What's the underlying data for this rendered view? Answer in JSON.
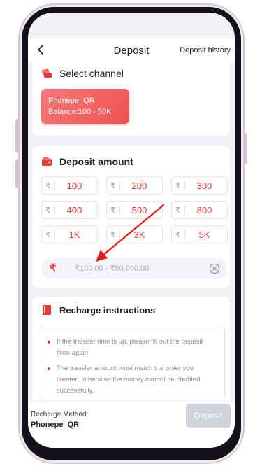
{
  "header": {
    "title": "Deposit",
    "history_link": "Deposit history"
  },
  "select_channel": {
    "title": "Select channel",
    "channel": {
      "name": "Phonepe_QR",
      "balance": "Balance:100 - 50K"
    }
  },
  "deposit_amount": {
    "title": "Deposit amount",
    "currency_symbol": "₹",
    "options": [
      "100",
      "200",
      "300",
      "400",
      "500",
      "800",
      "1K",
      "3K",
      "5K"
    ],
    "input": {
      "value": "",
      "placeholder": "₹100.00 - ₹50,000.00"
    }
  },
  "instructions": {
    "title": "Recharge instructions",
    "items": [
      "If the transfer time is up, please fill out the deposit form again.",
      "The transfer amount must match the order you created, otherwise the money cannot be credited successfully."
    ]
  },
  "footer": {
    "method_label": "Recharge Method:",
    "method_value": "Phonepe_QR",
    "deposit_button": "Deposit"
  },
  "colors": {
    "accent": "#e03c3c",
    "channel_gradient_start": "#f47a7a",
    "channel_gradient_end": "#f05050",
    "disabled_button": "#d0d3dc"
  }
}
